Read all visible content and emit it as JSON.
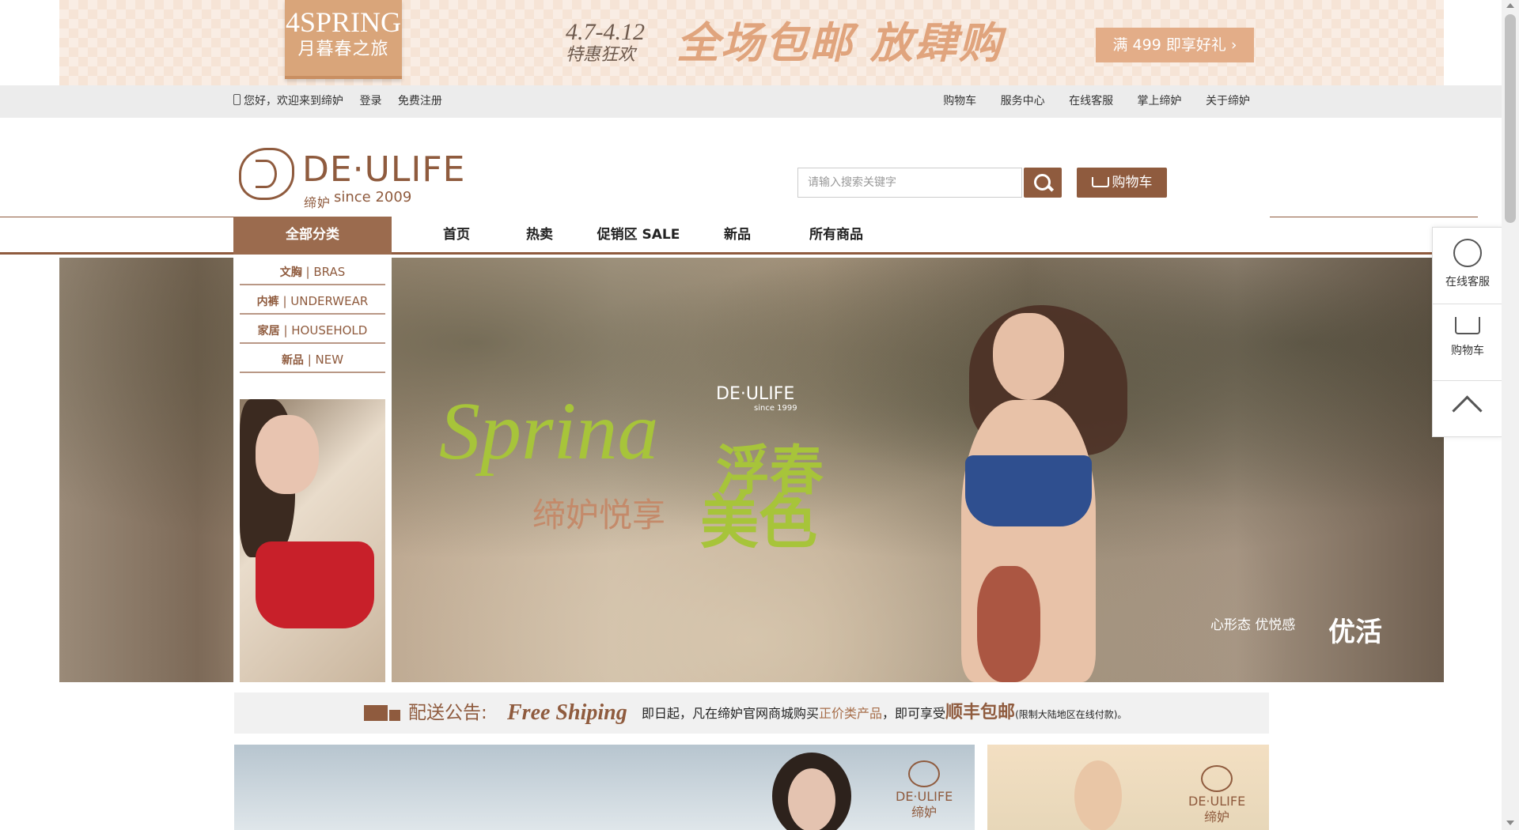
{
  "promo_banner": {
    "badge_line1": "4SPRING",
    "badge_line2": "月暮春之旅",
    "dates": "4.7-4.12",
    "dates_sub": "特惠狂欢",
    "headline": "全场包邮 放肆购",
    "cta": "满 499 即享好礼 ›"
  },
  "utilbar": {
    "welcome": "您好，欢迎来到缔妒",
    "login": "登录",
    "register": "免费注册",
    "right_links": [
      "购物车",
      "服务中心",
      "在线客服",
      "掌上缔妒",
      "关于缔妒"
    ]
  },
  "header": {
    "logo_name": "DE·ULIFE",
    "logo_cn": "缔妒",
    "logo_since": "since 2009",
    "search_placeholder": "请输入搜索关键字",
    "cart_label": "购物车"
  },
  "nav": {
    "all_label": "全部分类",
    "items": [
      "首页",
      "热卖",
      "促销区 SALE",
      "新品",
      "所有商品"
    ]
  },
  "categories": [
    {
      "cn": "文胸",
      "en": "BRAS"
    },
    {
      "cn": "内裤",
      "en": "UNDERWEAR"
    },
    {
      "cn": "家居",
      "en": "HOUSEHOLD"
    },
    {
      "cn": "新品",
      "en": "NEW"
    }
  ],
  "hero": {
    "logo": "DE·ULIFE",
    "logo_since": "since 1999",
    "script": "Sprina",
    "title_cn": "浮春",
    "subtitle": "缔妒悦享",
    "subtitle2": "美色",
    "brand_left": "心形态 优悦感",
    "brand_right": "优活"
  },
  "notice": {
    "title": "配送公告:",
    "script": "Free Shiping",
    "text_pre": "即日起，凡在缔妒官网商城购买",
    "text_hl": "正价类产品",
    "text_mid": "，即可享受",
    "text_big": "顺丰包邮",
    "text_small": "(限制大陆地区在线付款)。"
  },
  "bottom_promos": {
    "a_logo": "DE·ULIFE",
    "a_logo_cn": "缔妒",
    "b_logo": "DE·ULIFE",
    "b_logo_cn": "缔妒"
  },
  "float_panel": {
    "service": "在线客服",
    "cart": "购物车"
  },
  "colors": {
    "brand": "#8f5b3e",
    "nav_all_bg": "#9b6b4e",
    "hero_green": "#a7c43a",
    "promo_bg": "#f6e4d6"
  }
}
